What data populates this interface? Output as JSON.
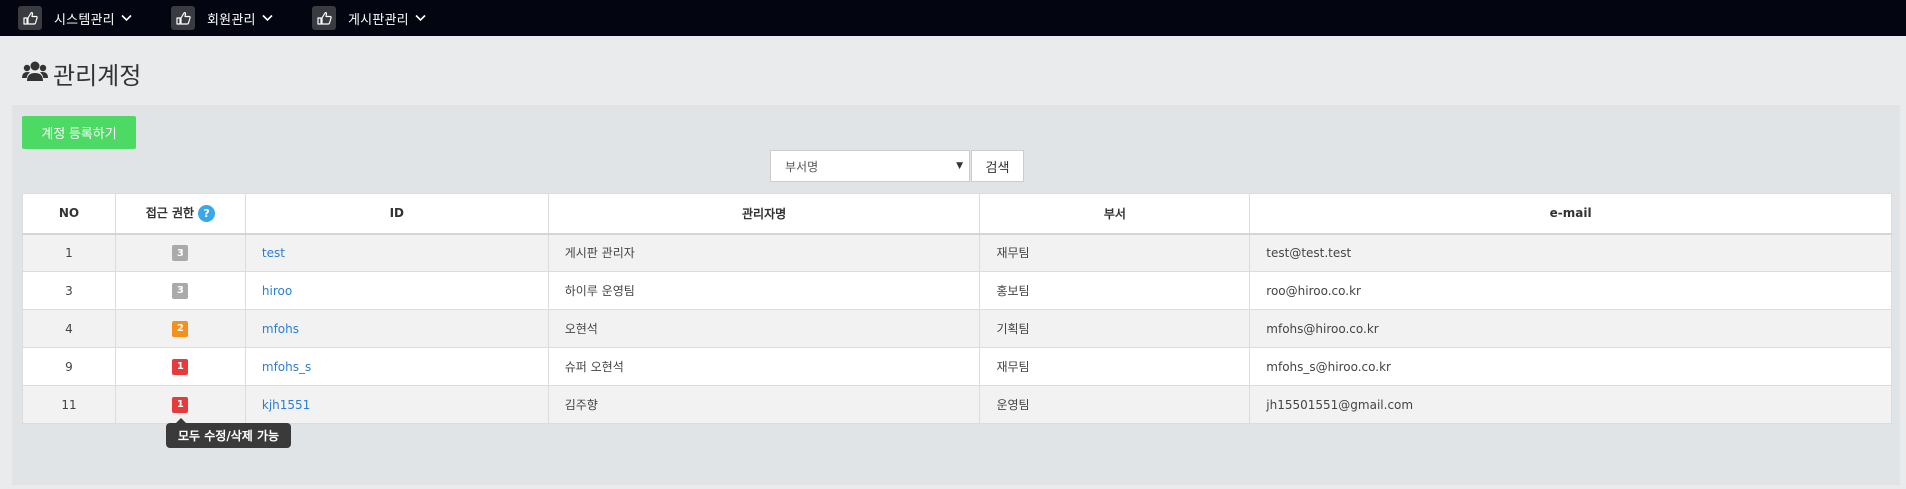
{
  "nav": {
    "items": [
      {
        "label": "시스템관리",
        "icon": "pointing-hand-icon"
      },
      {
        "label": "회원관리",
        "icon": "pointing-hand-icon"
      },
      {
        "label": "게시판관리",
        "icon": "pointing-hand-icon"
      }
    ]
  },
  "page": {
    "title": "관리계정",
    "title_icon": "users-icon"
  },
  "toolbar": {
    "register_label": "계정 등록하기",
    "search_select_value": "부서명",
    "search_label": "검색"
  },
  "table": {
    "headers": {
      "no": "NO",
      "access": "접근 권한",
      "help": "?",
      "id": "ID",
      "name": "관리자명",
      "dept": "부서",
      "email": "e-mail"
    },
    "rows": [
      {
        "no": "1",
        "level": "3",
        "level_color": "#aaaaaa",
        "id": "test",
        "name": "게시판 관리자",
        "dept": "재무팀",
        "email": "test@test.test"
      },
      {
        "no": "3",
        "level": "3",
        "level_color": "#aaaaaa",
        "id": "hiroo",
        "name": "하이루 운영팀",
        "dept": "홍보팀",
        "email": "roo@hiroo.co.kr"
      },
      {
        "no": "4",
        "level": "2",
        "level_color": "#f5901e",
        "id": "mfohs",
        "name": "오현석",
        "dept": "기획팀",
        "email": "mfohs@hiroo.co.kr"
      },
      {
        "no": "9",
        "level": "1",
        "level_color": "#e83a3a",
        "id": "mfohs_s",
        "name": "슈퍼 오현석",
        "dept": "재무팀",
        "email": "mfohs_s@hiroo.co.kr"
      },
      {
        "no": "11",
        "level": "1",
        "level_color": "#e83a3a",
        "id": "kjh1551",
        "name": "김주향",
        "dept": "운영팀",
        "email": "jh15501551@gmail.com"
      }
    ]
  },
  "tooltip": {
    "text": "모두 수정/삭제 가능"
  },
  "colors": {
    "topbar": "#030510",
    "register_button": "#4cd964",
    "link": "#2a7fd4",
    "help_badge": "#3aa8e8"
  }
}
